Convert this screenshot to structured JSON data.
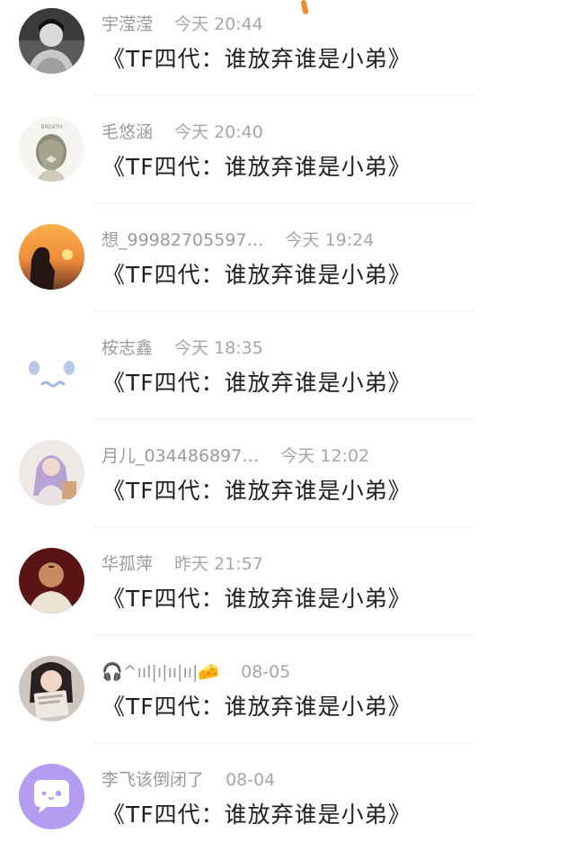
{
  "comments": [
    {
      "name": "宇滢滢",
      "time": "今天 20:44",
      "message": "《TF四代：谁放弃谁是小弟》",
      "avatar_icon": "avatar-photo-person-bw"
    },
    {
      "name": "毛悠涵",
      "time": "今天 20:40",
      "message": "《TF四代：谁放弃谁是小弟》",
      "avatar_icon": "avatar-girl-hair-bow"
    },
    {
      "name": "想_99982705597…",
      "time": "今天 19:24",
      "message": "《TF四代：谁放弃谁是小弟》",
      "avatar_icon": "avatar-sunset-silhouette"
    },
    {
      "name": "桉志鑫",
      "time": "今天 18:35",
      "message": "《TF四代：谁放弃谁是小弟》",
      "avatar_icon": "avatar-cute-face"
    },
    {
      "name": "月儿_034486897…",
      "time": "今天 12:02",
      "message": "《TF四代：谁放弃谁是小弟》",
      "avatar_icon": "avatar-purple-hair-girl"
    },
    {
      "name": "华孤萍",
      "time": "昨天 21:57",
      "message": "《TF四代：谁放弃谁是小弟》",
      "avatar_icon": "avatar-man-portrait"
    },
    {
      "name": "🎧^ııl|ı|ıı|ıı|🧀",
      "time": "08-05",
      "message": "《TF四代：谁放弃谁是小弟》",
      "avatar_icon": "avatar-girl-with-book"
    },
    {
      "name": "李飞该倒闭了",
      "time": "08-04",
      "message": "《TF四代：谁放弃谁是小弟》",
      "avatar_icon": "default-chat-bubble-avatar"
    }
  ],
  "colors": {
    "name_text": "#9a9a9a",
    "message_text": "#1f1f1f",
    "default_avatar_bg": "#b49cf0",
    "accent_mark": "#f08a2c"
  }
}
